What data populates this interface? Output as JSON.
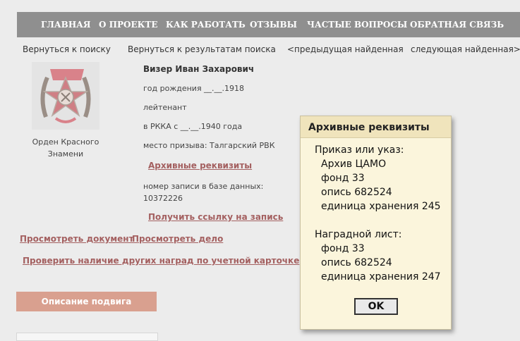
{
  "topnav": {
    "items": [
      "ГЛАВНАЯ",
      "О ПРОЕКТЕ",
      "КАК РАБОТАТЬ",
      "ОТЗЫВЫ",
      "ЧАСТЫЕ ВОПРОСЫ",
      "ОБРАТНАЯ СВЯЗЬ"
    ]
  },
  "subnav": {
    "back_search": "Вернуться к поиску",
    "back_results": "Вернуться к результатам поиска",
    "prev": "<предыдущая найденная",
    "next": "следующая найденная>"
  },
  "award": {
    "icon": "order-red-banner-icon",
    "caption": "Орден Красного Знамени"
  },
  "person": {
    "name": "Визер Иван Захарович",
    "birth": "год рождения __.__.1918",
    "rank": "лейтенант",
    "rkka": "в РККА с __.__.1940 года",
    "draft": "место призыва: Талгарский РВК",
    "archive_link": "Архивные реквизиты",
    "record_label": "номер записи в базе данных:",
    "record_number": "10372226",
    "get_link": "Получить ссылку на запись"
  },
  "links": {
    "view_doc": "Просмотреть документ",
    "view_case": "Просмотреть дело",
    "check_awards": "Проверить наличие других наград по учетной карточке"
  },
  "buttons": {
    "podvig": "Описание подвига"
  },
  "popup": {
    "title": "Архивные реквизиты",
    "order_label": "Приказ или указ:",
    "order_archive": "Архив ЦАМО",
    "order_fond": "фонд 33",
    "order_opis": "опись 682524",
    "order_unit": "единица хранения 245",
    "sheet_label": "Наградной лист:",
    "sheet_fond": "фонд 33",
    "sheet_opis": "опись 682524",
    "sheet_unit": "единица хранения 247",
    "ok": "OK"
  },
  "colors": {
    "nav_bg": "#8f8f8f",
    "link": "#a46060",
    "button_bg": "#d9a08f",
    "popup_bg": "#fbf5dc",
    "popup_header": "#f0e4bc"
  }
}
